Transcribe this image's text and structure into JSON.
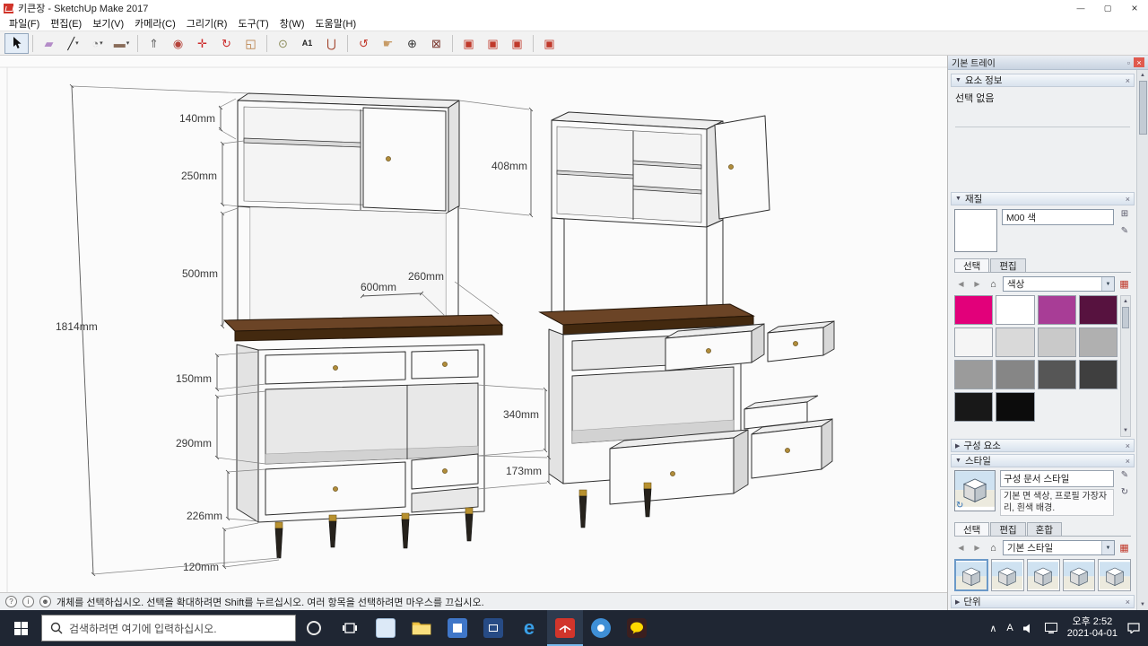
{
  "window": {
    "title": "키큰장 - SketchUp Make 2017",
    "controls": {
      "minimize": "—",
      "maximize": "▢",
      "close": "×"
    }
  },
  "menu": {
    "items": [
      "파일(F)",
      "편집(E)",
      "보기(V)",
      "카메라(C)",
      "그리기(R)",
      "도구(T)",
      "창(W)",
      "도움말(H)"
    ]
  },
  "toolbar": {
    "tools": [
      {
        "name": "select",
        "glyph": "",
        "color": "#111111"
      },
      {
        "name": "eraser",
        "glyph": "▰",
        "color": "#b48cc8"
      },
      {
        "name": "line",
        "glyph": "╱",
        "color": "#222222"
      },
      {
        "name": "arc",
        "glyph": "◔",
        "color": "#777777"
      },
      {
        "name": "shapes",
        "glyph": "▬",
        "color": "#8a6d5a"
      },
      {
        "name": "push-pull",
        "glyph": "⇑",
        "color": "#666666"
      },
      {
        "name": "offset",
        "glyph": "◉",
        "color": "#b5433a"
      },
      {
        "name": "move",
        "glyph": "✛",
        "color": "#cc2b2b"
      },
      {
        "name": "rotate",
        "glyph": "↻",
        "color": "#cc2b2b"
      },
      {
        "name": "scale",
        "glyph": "◱",
        "color": "#b5763a"
      },
      {
        "name": "tape-measure",
        "glyph": "⊙",
        "color": "#8c8c5a"
      },
      {
        "name": "dimension-text",
        "glyph": "A1",
        "color": "#222222"
      },
      {
        "name": "paint-bucket",
        "glyph": "⋃",
        "color": "#a04028"
      },
      {
        "name": "orbit",
        "glyph": "↺",
        "color": "#c23b2e"
      },
      {
        "name": "pan",
        "glyph": "☛",
        "color": "#c79b66"
      },
      {
        "name": "zoom",
        "glyph": "⊕",
        "color": "#333333"
      },
      {
        "name": "zoom-extents",
        "glyph": "⊠",
        "color": "#77332a"
      },
      {
        "name": "3d-warehouse",
        "glyph": "▣",
        "color": "#c0392b"
      },
      {
        "name": "share-model",
        "glyph": "▣",
        "color": "#c0392b"
      },
      {
        "name": "extension-warehouse",
        "glyph": "▣",
        "color": "#c0392b"
      },
      {
        "name": "layout",
        "glyph": "▣",
        "color": "#c0392b"
      }
    ]
  },
  "canvas": {
    "dims": {
      "d140": "140mm",
      "d250": "250mm",
      "d500": "500mm",
      "d1814": "1814mm",
      "d150": "150mm",
      "d290": "290mm",
      "d226": "226mm",
      "d120": "120mm",
      "d408": "408mm",
      "d260": "260mm",
      "d600": "600mm",
      "d340": "340mm",
      "d173": "173mm"
    }
  },
  "tray": {
    "title": "기본 트레이",
    "entity_info": {
      "title": "요소 정보",
      "empty_text": "선택 없음"
    },
    "materials": {
      "title": "재질",
      "material_name": "M00 색",
      "tab_select": "선택",
      "tab_edit": "편집",
      "collection": "색상",
      "swatches": [
        "#e2007a",
        "#ffffff",
        "#a83d96",
        "#57123f",
        "#f5f5f5",
        "#d9d9d9",
        "#c9c9c9",
        "#b0b0b0",
        "#9b9b9b",
        "#868686",
        "#565656",
        "#3f3f3f",
        "#181818",
        "#0c0c0c"
      ]
    },
    "components": {
      "title": "구성 요소"
    },
    "styles": {
      "title": "스타일",
      "style_name": "구성 문서 스타일",
      "style_desc": "기본 면 색상, 프로필 가장자리, 흰색 배경.",
      "tab_select": "선택",
      "tab_edit": "편집",
      "tab_mix": "혼합",
      "collection": "기본 스타일"
    },
    "units": {
      "title": "단위"
    }
  },
  "icons": {
    "caret_down": "▾",
    "dd_caret": "▼",
    "collapse_open": "▼",
    "collapse_closed": "▶",
    "close_x": "×",
    "pin": "▫",
    "back_arrow": "◀",
    "forward_arrow": "▶",
    "home": "⌂",
    "scroll_up": "▲",
    "scroll_down": "▼",
    "swatch_view": "▦",
    "refresh": "↻",
    "dropper": "✎",
    "create_material": "⊞",
    "chevron_up": "∧",
    "help": "?",
    "info": "i",
    "user": "☻"
  },
  "statusbar": {
    "message": "개체를 선택하십시오. 선택을 확대하려면 Shift를 누르십시오. 여러 항목을 선택하려면 마우스를 끄십시오."
  },
  "taskbar": {
    "search_placeholder": "검색하려면 여기에 입력하십시오.",
    "ime": "A",
    "time": "오후 2:52",
    "date": "2021-04-01"
  }
}
